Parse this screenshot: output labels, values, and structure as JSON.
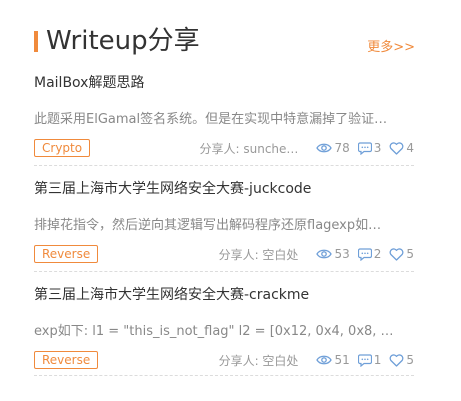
{
  "header": {
    "title": "Writeup分享",
    "more_label": "更多>>"
  },
  "items": [
    {
      "title": "MailBox解题思路",
      "desc": "此题采用ElGamal签名系统。但是在实现中特意漏掉了验证…",
      "tag": "Crypto",
      "author": "分享人:  sunche…",
      "views": "78",
      "comments": "3",
      "likes": "4"
    },
    {
      "title": "第三届上海市大学生网络安全大赛-juckcode",
      "desc": "排掉花指令，然后逆向其逻辑写出解码程序还原flagexp如…",
      "tag": "Reverse",
      "author": "分享人:  空白处",
      "views": "53",
      "comments": "2",
      "likes": "5"
    },
    {
      "title": "第三届上海市大学生网络安全大赛-crackme",
      "desc": "exp如下:  l1 = \"this_is_not_flag\" l2 = [0x12, 0x4, 0x8, …",
      "tag": "Reverse",
      "author": "分享人:  空白处",
      "views": "51",
      "comments": "1",
      "likes": "5"
    }
  ],
  "icons": {
    "views": "eye-icon",
    "comments": "comment-icon",
    "likes": "heart-icon"
  },
  "colors": {
    "accent": "#f08a3c",
    "icon_blue": "#6f9fd8",
    "text_dark": "#333333",
    "text_muted": "#888888"
  }
}
